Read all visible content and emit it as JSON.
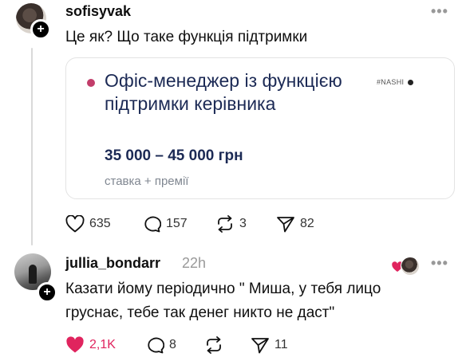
{
  "post": {
    "username": "sofisyvak",
    "text": "Це як? Що таке функція підтримки",
    "card": {
      "title": "Офіс-менеджер із функцією підтримки керівника",
      "salary": "35 000 – 45 000 грн",
      "note": "ставка + премії",
      "brand": "#NASHI"
    },
    "actions": {
      "likes": "635",
      "comments": "157",
      "reposts": "3",
      "shares": "82"
    }
  },
  "reply": {
    "username": "jullia_bondarr",
    "time": "22h",
    "text_line1": "Казати йому періодично \" Миша, у тебя лицо",
    "text_line2": "груснає,  тебе так денег никто не даст\"",
    "actions": {
      "likes": "2,1K",
      "comments": "8",
      "shares": "11"
    }
  },
  "colors": {
    "accent_pink": "#c23d6a",
    "card_text_navy": "#1c2a55",
    "liked_red": "#e0245e"
  },
  "icons": [
    "heart-icon",
    "comment-icon",
    "repost-icon",
    "share-icon",
    "more-icon",
    "plus-icon"
  ]
}
